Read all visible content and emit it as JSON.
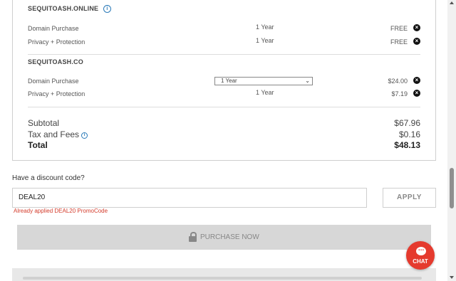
{
  "cart": {
    "domains": [
      {
        "name": "SEQUITOASH.ONLINE",
        "items": [
          {
            "label": "Domain Purchase",
            "term": "1 Year",
            "price": "FREE"
          },
          {
            "label": "Privacy + Protection",
            "term": "1 Year",
            "price": "FREE"
          }
        ]
      },
      {
        "name": "SEQUITOASH.CO",
        "items": [
          {
            "label": "Domain Purchase",
            "term": "1 Year",
            "price": "$24.00"
          },
          {
            "label": "Privacy + Protection",
            "term": "1 Year",
            "price": "$7.19"
          }
        ]
      }
    ],
    "summary": {
      "subtotal_label": "Subtotal",
      "subtotal": "$67.96",
      "tax_label": "Tax and Fees",
      "tax": "$0.16",
      "total_label": "Total",
      "total": "$48.13"
    }
  },
  "discount": {
    "heading": "Have a discount code?",
    "code_value": "DEAL20",
    "apply_label": "APPLY",
    "status_message": "Already applied DEAL20 PromoCode"
  },
  "purchase": {
    "label": "PURCHASE NOW",
    "icon": "lock-icon"
  },
  "chat": {
    "label": "CHAT",
    "icon": "chat-bubble-icon",
    "color": "#e53a2e"
  },
  "colors": {
    "error": "#d43c2c",
    "info": "#2a7ab8",
    "disabled_button": "#d7d7d7"
  }
}
